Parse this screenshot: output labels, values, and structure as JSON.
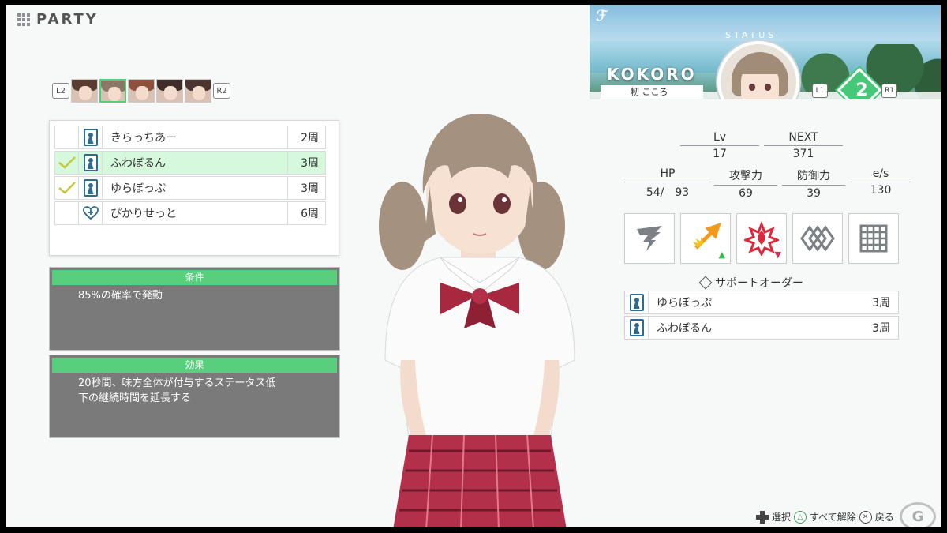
{
  "header": {
    "title": "PARTY"
  },
  "portrait_row": {
    "left_button": "L2",
    "right_button": "R2"
  },
  "order_list": [
    {
      "checked": false,
      "type": "order",
      "name": "きらっちあー",
      "laps": "2周",
      "selected": false
    },
    {
      "checked": true,
      "type": "order",
      "name": "ふわぼるん",
      "laps": "3周",
      "selected": true
    },
    {
      "checked": true,
      "type": "order",
      "name": "ゆらぼっぷ",
      "laps": "3周",
      "selected": false
    },
    {
      "checked": false,
      "type": "heart",
      "name": "ぴかりせっと",
      "laps": "6周",
      "selected": false
    }
  ],
  "condition": {
    "header": "条件",
    "text": "85%の確率で発動"
  },
  "effect": {
    "header": "効果",
    "text": "20秒間、味方全体が付与するステータス低\n下の継続時間を延長する"
  },
  "status": {
    "label": "STATUS",
    "name": "KOKORO",
    "name_jp": "籾 こころ",
    "l_button": "L1",
    "r_button": "R1",
    "level_badge": "2"
  },
  "stats": {
    "lv_label": "Lv",
    "lv_value": "17",
    "next_label": "NEXT",
    "next_value": "371",
    "hp_label": "HP",
    "hp_value": "54/　93",
    "atk_label": "攻撃力",
    "atk_value": "69",
    "def_label": "防御力",
    "def_value": "39",
    "es_label": "e/s",
    "es_value": "130"
  },
  "skills": [
    {
      "icon": "claw-icon",
      "color": "#7c8186"
    },
    {
      "icon": "arrow-burst-icon",
      "color": "#f39a1e",
      "modifier": "up"
    },
    {
      "icon": "flame-burst-icon",
      "color": "#e0283c",
      "modifier": "down"
    },
    {
      "icon": "diamond-chain-icon",
      "color": "#7c8186"
    },
    {
      "icon": "grid-icon",
      "color": "#7c8186"
    }
  ],
  "support": {
    "title": "サポートオーダー",
    "items": [
      {
        "name": "ゆらぼっぷ",
        "laps": "3周"
      },
      {
        "name": "ふわぼるん",
        "laps": "3周"
      }
    ]
  },
  "hints": {
    "select": "選択",
    "clear_all": "すべて解除",
    "back": "戻る"
  },
  "colors": {
    "accent": "#58cf7c",
    "order_icon": "#2d6b8f",
    "selected_row": "#d6f8dd"
  }
}
